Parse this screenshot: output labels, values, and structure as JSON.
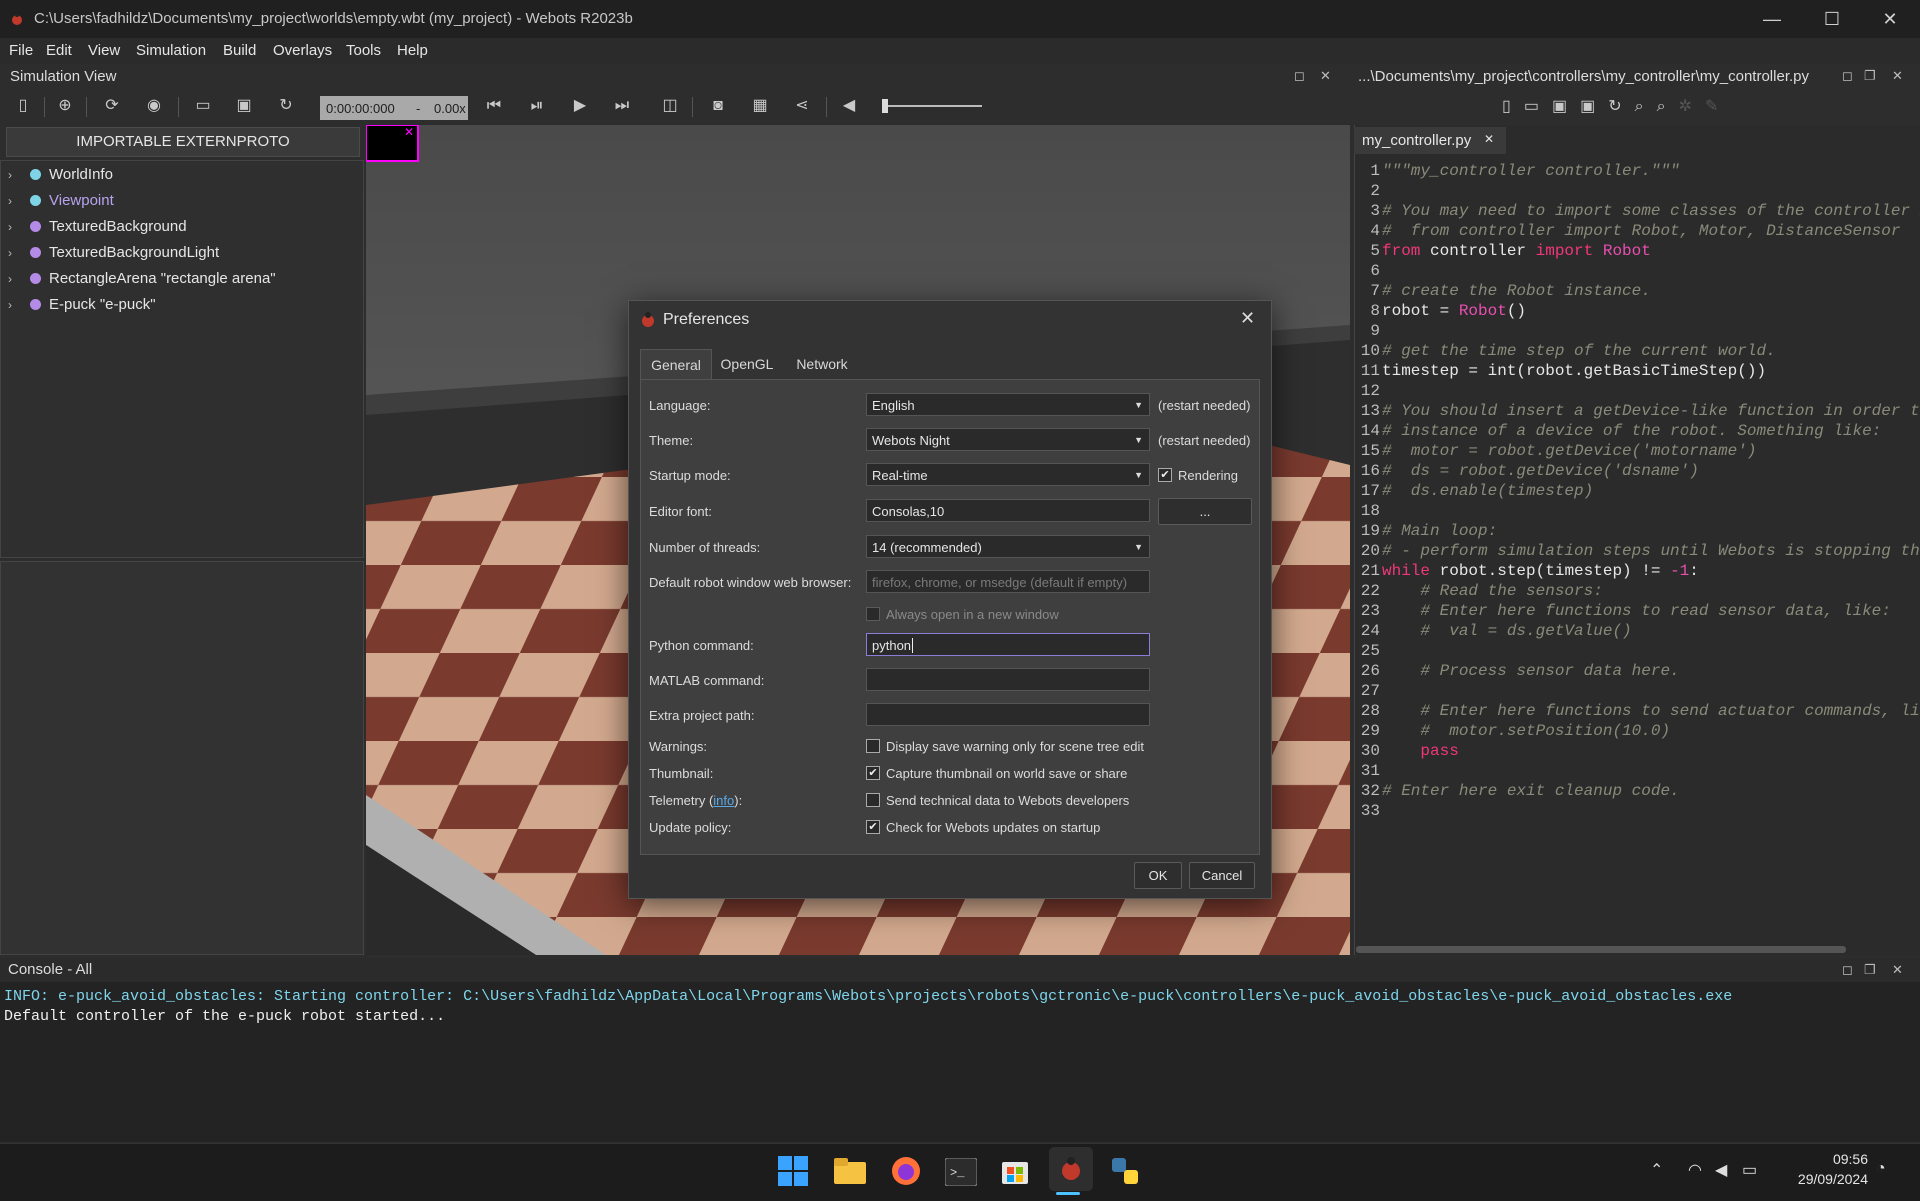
{
  "window": {
    "title": "C:\\Users\\fadhildz\\Documents\\my_project\\worlds\\empty.wbt (my_project) - Webots R2023b",
    "minimize": "—",
    "maximize": "☐",
    "close": "✕"
  },
  "menu": [
    "File",
    "Edit",
    "View",
    "Simulation",
    "Build",
    "Overlays",
    "Tools",
    "Help"
  ],
  "sim_view": {
    "title": "Simulation View",
    "time": "0:00:00:000",
    "separator": "-",
    "speed": "0.00x"
  },
  "scene_tree": {
    "extern_button": "IMPORTABLE EXTERNPROTO",
    "items": [
      {
        "label": "WorldInfo",
        "color": "#7fd3e6"
      },
      {
        "label": "Viewpoint",
        "color": "#7fd3e6",
        "highlight": true
      },
      {
        "label": "TexturedBackground",
        "color": "#b58be8"
      },
      {
        "label": "TexturedBackgroundLight",
        "color": "#b58be8"
      },
      {
        "label": "RectangleArena \"rectangle arena\"",
        "color": "#b58be8"
      },
      {
        "label": "E-puck \"e-puck\"",
        "color": "#b58be8"
      }
    ]
  },
  "editor": {
    "path": "...\\Documents\\my_project\\controllers\\my_controller\\my_controller.py",
    "tab": "my_controller.py",
    "tab_close": "✕"
  },
  "console": {
    "title": "Console - All",
    "lines": [
      "INFO: e-puck_avoid_obstacles: Starting controller: C:\\Users\\fadhildz\\AppData\\Local\\Programs\\Webots\\projects\\robots\\gctronic\\e-puck\\controllers\\e-puck_avoid_obstacles\\e-puck_avoid_obstacles.exe",
      "Default controller of the e-puck robot started..."
    ]
  },
  "preferences": {
    "title": "Preferences",
    "close": "✕",
    "tabs": [
      "General",
      "OpenGL",
      "Network"
    ],
    "language_label": "Language:",
    "language_value": "English",
    "restart_note": "(restart needed)",
    "theme_label": "Theme:",
    "theme_value": "Webots Night",
    "startup_label": "Startup mode:",
    "startup_value": "Real-time",
    "rendering_label": "Rendering",
    "font_label": "Editor font:",
    "font_value": "Consolas,10",
    "font_button": "...",
    "threads_label": "Number of threads:",
    "threads_value": "14 (recommended)",
    "browser_label": "Default robot window web browser:",
    "browser_placeholder": "firefox, chrome, or msedge (default if empty)",
    "new_window_label": "Always open in a new window",
    "python_label": "Python command:",
    "python_value": "python",
    "matlab_label": "MATLAB command:",
    "extra_label": "Extra project path:",
    "warnings_label": "Warnings:",
    "warnings_text": "Display save warning only for scene tree edit",
    "thumbnail_label": "Thumbnail:",
    "thumbnail_text": "Capture thumbnail on world save or share",
    "telemetry_prefix": "Telemetry (",
    "telemetry_link": "info",
    "telemetry_suffix": "):",
    "telemetry_text": "Send technical data to Webots developers",
    "update_label": "Update policy:",
    "update_text": "Check for Webots updates on startup",
    "ok": "OK",
    "cancel": "Cancel"
  },
  "taskbar": {
    "time": "09:56",
    "date": "29/09/2024"
  }
}
